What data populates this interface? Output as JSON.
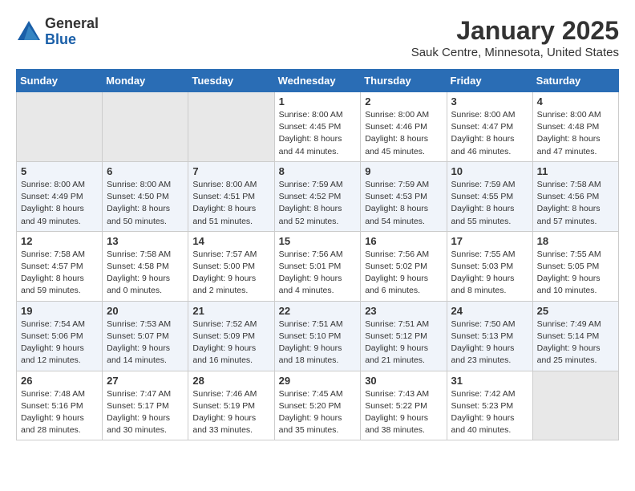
{
  "logo": {
    "general": "General",
    "blue": "Blue"
  },
  "title": "January 2025",
  "subtitle": "Sauk Centre, Minnesota, United States",
  "headers": [
    "Sunday",
    "Monday",
    "Tuesday",
    "Wednesday",
    "Thursday",
    "Friday",
    "Saturday"
  ],
  "weeks": [
    [
      {
        "day": "",
        "info": ""
      },
      {
        "day": "",
        "info": ""
      },
      {
        "day": "",
        "info": ""
      },
      {
        "day": "1",
        "info": "Sunrise: 8:00 AM\nSunset: 4:45 PM\nDaylight: 8 hours\nand 44 minutes."
      },
      {
        "day": "2",
        "info": "Sunrise: 8:00 AM\nSunset: 4:46 PM\nDaylight: 8 hours\nand 45 minutes."
      },
      {
        "day": "3",
        "info": "Sunrise: 8:00 AM\nSunset: 4:47 PM\nDaylight: 8 hours\nand 46 minutes."
      },
      {
        "day": "4",
        "info": "Sunrise: 8:00 AM\nSunset: 4:48 PM\nDaylight: 8 hours\nand 47 minutes."
      }
    ],
    [
      {
        "day": "5",
        "info": "Sunrise: 8:00 AM\nSunset: 4:49 PM\nDaylight: 8 hours\nand 49 minutes."
      },
      {
        "day": "6",
        "info": "Sunrise: 8:00 AM\nSunset: 4:50 PM\nDaylight: 8 hours\nand 50 minutes."
      },
      {
        "day": "7",
        "info": "Sunrise: 8:00 AM\nSunset: 4:51 PM\nDaylight: 8 hours\nand 51 minutes."
      },
      {
        "day": "8",
        "info": "Sunrise: 7:59 AM\nSunset: 4:52 PM\nDaylight: 8 hours\nand 52 minutes."
      },
      {
        "day": "9",
        "info": "Sunrise: 7:59 AM\nSunset: 4:53 PM\nDaylight: 8 hours\nand 54 minutes."
      },
      {
        "day": "10",
        "info": "Sunrise: 7:59 AM\nSunset: 4:55 PM\nDaylight: 8 hours\nand 55 minutes."
      },
      {
        "day": "11",
        "info": "Sunrise: 7:58 AM\nSunset: 4:56 PM\nDaylight: 8 hours\nand 57 minutes."
      }
    ],
    [
      {
        "day": "12",
        "info": "Sunrise: 7:58 AM\nSunset: 4:57 PM\nDaylight: 8 hours\nand 59 minutes."
      },
      {
        "day": "13",
        "info": "Sunrise: 7:58 AM\nSunset: 4:58 PM\nDaylight: 9 hours\nand 0 minutes."
      },
      {
        "day": "14",
        "info": "Sunrise: 7:57 AM\nSunset: 5:00 PM\nDaylight: 9 hours\nand 2 minutes."
      },
      {
        "day": "15",
        "info": "Sunrise: 7:56 AM\nSunset: 5:01 PM\nDaylight: 9 hours\nand 4 minutes."
      },
      {
        "day": "16",
        "info": "Sunrise: 7:56 AM\nSunset: 5:02 PM\nDaylight: 9 hours\nand 6 minutes."
      },
      {
        "day": "17",
        "info": "Sunrise: 7:55 AM\nSunset: 5:03 PM\nDaylight: 9 hours\nand 8 minutes."
      },
      {
        "day": "18",
        "info": "Sunrise: 7:55 AM\nSunset: 5:05 PM\nDaylight: 9 hours\nand 10 minutes."
      }
    ],
    [
      {
        "day": "19",
        "info": "Sunrise: 7:54 AM\nSunset: 5:06 PM\nDaylight: 9 hours\nand 12 minutes."
      },
      {
        "day": "20",
        "info": "Sunrise: 7:53 AM\nSunset: 5:07 PM\nDaylight: 9 hours\nand 14 minutes."
      },
      {
        "day": "21",
        "info": "Sunrise: 7:52 AM\nSunset: 5:09 PM\nDaylight: 9 hours\nand 16 minutes."
      },
      {
        "day": "22",
        "info": "Sunrise: 7:51 AM\nSunset: 5:10 PM\nDaylight: 9 hours\nand 18 minutes."
      },
      {
        "day": "23",
        "info": "Sunrise: 7:51 AM\nSunset: 5:12 PM\nDaylight: 9 hours\nand 21 minutes."
      },
      {
        "day": "24",
        "info": "Sunrise: 7:50 AM\nSunset: 5:13 PM\nDaylight: 9 hours\nand 23 minutes."
      },
      {
        "day": "25",
        "info": "Sunrise: 7:49 AM\nSunset: 5:14 PM\nDaylight: 9 hours\nand 25 minutes."
      }
    ],
    [
      {
        "day": "26",
        "info": "Sunrise: 7:48 AM\nSunset: 5:16 PM\nDaylight: 9 hours\nand 28 minutes."
      },
      {
        "day": "27",
        "info": "Sunrise: 7:47 AM\nSunset: 5:17 PM\nDaylight: 9 hours\nand 30 minutes."
      },
      {
        "day": "28",
        "info": "Sunrise: 7:46 AM\nSunset: 5:19 PM\nDaylight: 9 hours\nand 33 minutes."
      },
      {
        "day": "29",
        "info": "Sunrise: 7:45 AM\nSunset: 5:20 PM\nDaylight: 9 hours\nand 35 minutes."
      },
      {
        "day": "30",
        "info": "Sunrise: 7:43 AM\nSunset: 5:22 PM\nDaylight: 9 hours\nand 38 minutes."
      },
      {
        "day": "31",
        "info": "Sunrise: 7:42 AM\nSunset: 5:23 PM\nDaylight: 9 hours\nand 40 minutes."
      },
      {
        "day": "",
        "info": ""
      }
    ]
  ]
}
